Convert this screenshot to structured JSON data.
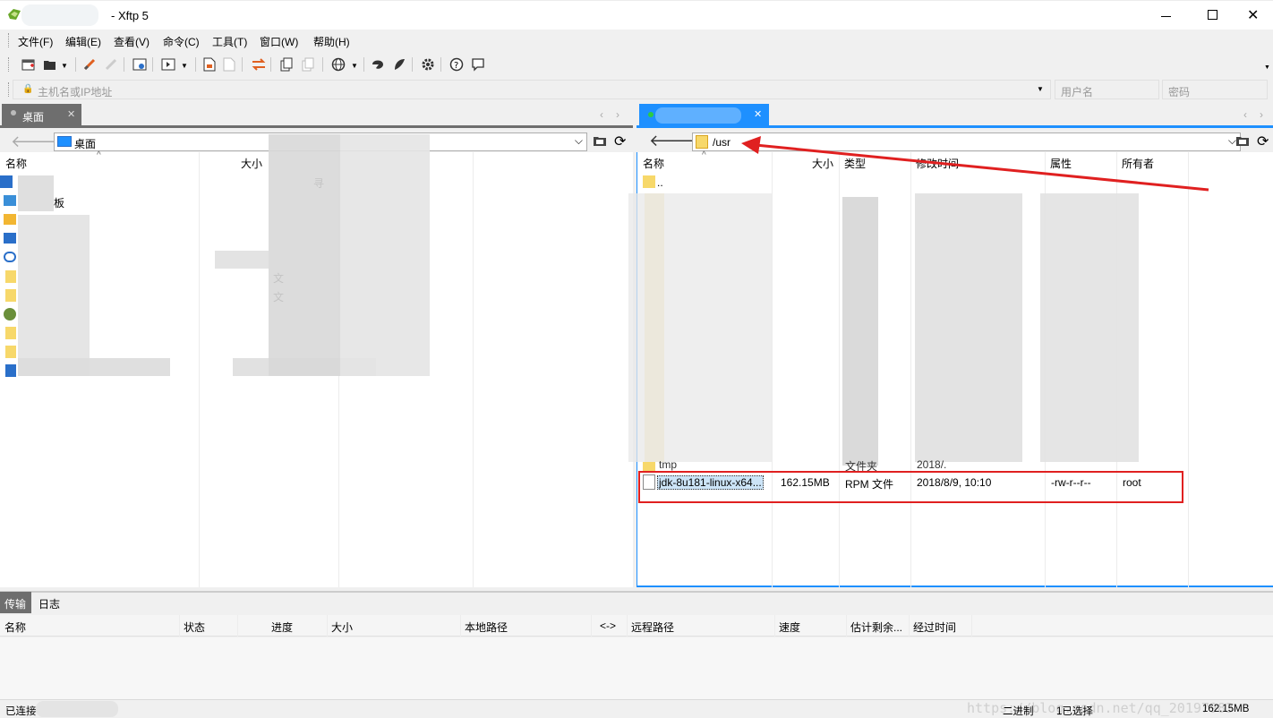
{
  "window": {
    "title": "- Xftp 5"
  },
  "menu": [
    "文件(F)",
    "编辑(E)",
    "查看(V)",
    "命令(C)",
    "工具(T)",
    "窗口(W)",
    "帮助(H)"
  ],
  "address": {
    "host_placeholder": "主机名或IP地址",
    "user_placeholder": "用户名",
    "password_placeholder": "密码"
  },
  "local": {
    "tab_label": "桌面",
    "path": "桌面",
    "columns": [
      "名称",
      "大小"
    ],
    "visible_fragments": [
      "板",
      "寻",
      "文",
      "文"
    ]
  },
  "remote": {
    "path": "/usr",
    "columns": [
      "名称",
      "大小",
      "类型",
      "修改时间",
      "属性",
      "所有者"
    ],
    "parent": "..",
    "partial_row": {
      "name": "tmp",
      "type": "文件夹",
      "modified": "2018/."
    },
    "selected_file": {
      "name": "jdk-8u181-linux-x64...",
      "size": "162.15MB",
      "type": "RPM 文件",
      "modified": "2018/8/9, 10:10",
      "attributes": "-rw-r--r--",
      "owner": "root"
    }
  },
  "bottom_tabs": [
    "传输",
    "日志"
  ],
  "transfer_columns": [
    "名称",
    "状态",
    "进度",
    "大小",
    "本地路径",
    "<->",
    "远程路径",
    "速度",
    "估计剩余...",
    "经过时间"
  ],
  "status": {
    "connection": "已连接",
    "mode": "二进制",
    "selection": "1已选择",
    "size": "162.15MB"
  },
  "watermark": "https://blog.csdn.net/qq_20197983",
  "colors": {
    "accent": "#1e90ff",
    "highlight_red": "#e02020",
    "tab_dark": "#6e6e6e",
    "folder": "#f7d86a"
  }
}
